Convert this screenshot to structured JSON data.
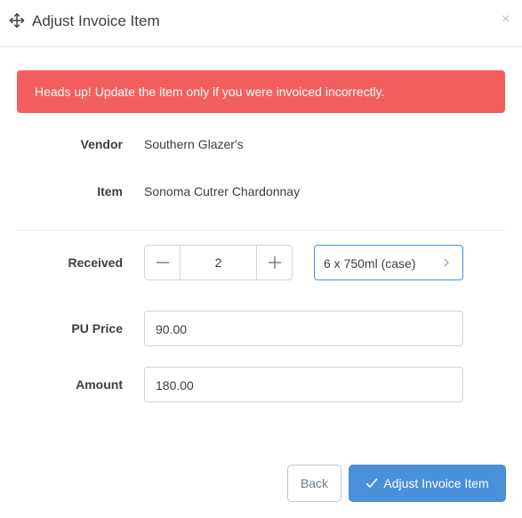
{
  "modal": {
    "title": "Adjust Invoice Item",
    "move_icon": "move-arrows-icon",
    "close_glyph": "×"
  },
  "alert": {
    "message": "Heads up! Update the item only if you were invoiced incorrectly.",
    "color": "#f35f5f"
  },
  "details": {
    "vendor_label": "Vendor",
    "vendor_value": "Southern Glazer's",
    "item_label": "Item",
    "item_value": "Sonoma Cutrer Chardonnay"
  },
  "received": {
    "label": "Received",
    "quantity": "2",
    "unit": "6 x 750ml (case)"
  },
  "pu_price": {
    "label": "PU Price",
    "value": "90.00"
  },
  "amount": {
    "label": "Amount",
    "value": "180.00"
  },
  "footer": {
    "back_label": "Back",
    "submit_label": "Adjust Invoice Item",
    "accent": "#4a8fd9"
  }
}
